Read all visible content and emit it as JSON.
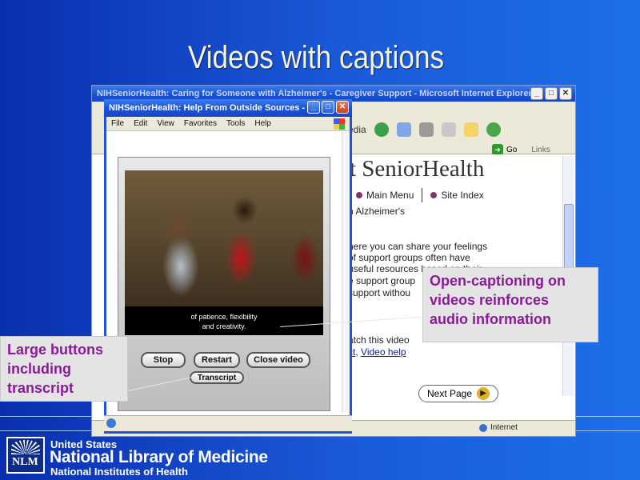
{
  "slide": {
    "title": "Videos with captions"
  },
  "back_browser": {
    "title": "NIHSeniorHealth: Caring for Someone with Alzheimer's - Caregiver Support - Microsoft Internet Explorer",
    "toolbar_fragment": "edia",
    "go_label": "Go",
    "links_label": "Links",
    "brand_fragment": "t SeniorHealth",
    "menu": [
      "Main Menu",
      "Site Index"
    ],
    "body_lines": [
      "n Alzheimer's",
      "here you can share your feelings",
      " of support groups often have",
      " useful resources based on their",
      "e support group",
      " support withou"
    ],
    "watch_text": "atch this video",
    "link_fragment_a": "ct",
    "link_separator": ",",
    "link_video_help": "Video help",
    "next_page": "Next Page",
    "status_zone": "Internet"
  },
  "popup": {
    "title": "NIHSeniorHealth: Help From Outside Sources - ...",
    "menu": [
      "File",
      "Edit",
      "View",
      "Favorites",
      "Tools",
      "Help"
    ],
    "caption_lines": [
      "of patience, flexibility",
      "and creativity."
    ],
    "buttons": {
      "stop": "Stop",
      "restart": "Restart",
      "close_video": "Close video",
      "transcript": "Transcript"
    }
  },
  "callouts": {
    "left": [
      "Large buttons",
      "including",
      "transcript"
    ],
    "right": [
      "Open-captioning on",
      "videos reinforces",
      "audio information"
    ]
  },
  "footer": {
    "logo": "NLM",
    "line1": "United States",
    "line2": "National Library of Medicine",
    "line3": "National Institutes of Health"
  },
  "colors": {
    "background": "#1646c4",
    "title": "#f4f4d8",
    "callout_text": "#8b1a9a",
    "xp_titlebar": "#1b54d8"
  },
  "icons": [
    "minimize-icon",
    "maximize-icon",
    "close-icon",
    "windows-flag-icon",
    "globe-icon",
    "next-arrow-icon",
    "go-arrow-icon"
  ]
}
